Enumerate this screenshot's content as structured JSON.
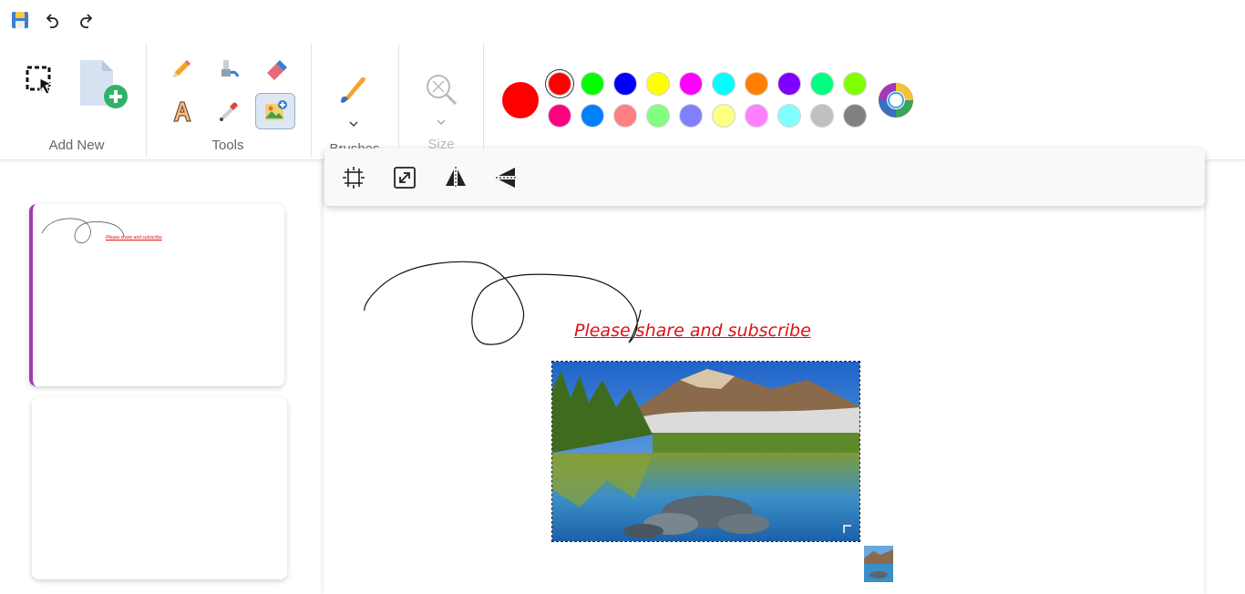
{
  "quick_access": {
    "save_icon": "save-icon",
    "undo_icon": "undo-icon",
    "redo_icon": "redo-icon"
  },
  "ribbon": {
    "add_new": {
      "label": "Add New",
      "items": [
        "select-icon",
        "new-page-icon"
      ]
    },
    "tools": {
      "label": "Tools",
      "items": [
        "pencil-icon",
        "fill-icon",
        "eraser-icon",
        "text-icon",
        "color-picker-icon",
        "image-icon"
      ],
      "active": "image-icon"
    },
    "brushes": {
      "label": "Brushes"
    },
    "size": {
      "label": "Size"
    },
    "colors": {
      "current": "#ff0000",
      "row1": [
        "#ff0000",
        "#00ff00",
        "#0000ff",
        "#ffff00",
        "#ff00ff",
        "#00ffff",
        "#ff8000",
        "#8000ff",
        "#00ff80",
        "#80ff00"
      ],
      "row2": [
        "#ff0080",
        "#0080ff",
        "#ff8080",
        "#80ff80",
        "#8080ff",
        "#ffff80",
        "#ff80ff",
        "#80ffff",
        "#c0c0c0",
        "#808080"
      ],
      "selected": "#ff0000"
    }
  },
  "image_toolbar": {
    "items": [
      "crop-icon",
      "resize-icon",
      "flip-horizontal-icon",
      "flip-vertical-icon"
    ]
  },
  "canvas": {
    "text": "Please share and subscribe",
    "text_color": "#e01010"
  },
  "slides": {
    "active_accent": "#a23ab8",
    "thumb1_text": "Please share and subscribe"
  }
}
